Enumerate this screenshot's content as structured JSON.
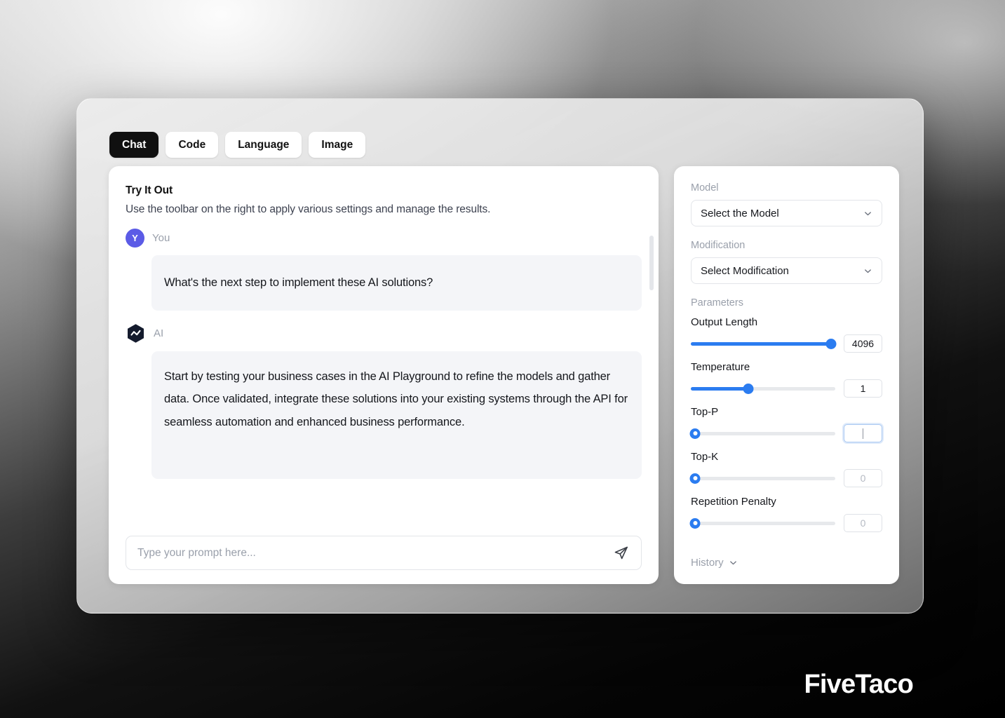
{
  "tabs": [
    {
      "label": "Chat",
      "active": true
    },
    {
      "label": "Code",
      "active": false
    },
    {
      "label": "Language",
      "active": false
    },
    {
      "label": "Image",
      "active": false
    }
  ],
  "chat": {
    "title": "Try It Out",
    "subtitle": "Use the toolbar on the right to apply various settings and manage the results.",
    "messages": [
      {
        "author": "You",
        "avatar_initial": "Y",
        "avatar_color": "#5b5be6",
        "text": "What's the next step to implement these AI solutions?"
      },
      {
        "author": "AI",
        "avatar_icon": "ai-hexagon-icon",
        "avatar_color": "#141b2d",
        "text": "Start by testing your business cases in the AI Playground to refine the models and gather data. Once validated, integrate these solutions into your existing systems through the API for seamless automation and enhanced business performance."
      }
    ],
    "composer": {
      "placeholder": "Type your prompt here...",
      "value": "",
      "send_icon": "send-paper-plane-icon"
    }
  },
  "settings": {
    "model": {
      "label": "Model",
      "selected": "Select the Model",
      "icon": "chevron-down-icon"
    },
    "modification": {
      "label": "Modification",
      "selected": "Select Modification",
      "icon": "chevron-down-icon"
    },
    "parameters_label": "Parameters",
    "parameters": [
      {
        "label": "Output Length",
        "value": "4096",
        "percent": 97,
        "filled": true,
        "muted": false,
        "focused": false
      },
      {
        "label": "Temperature",
        "value": "1",
        "percent": 40,
        "filled": true,
        "muted": false,
        "focused": false
      },
      {
        "label": "Top-P",
        "value": "",
        "percent": 3,
        "filled": false,
        "muted": false,
        "focused": true
      },
      {
        "label": "Top-K",
        "value": "0",
        "percent": 3,
        "filled": false,
        "muted": true,
        "focused": false
      },
      {
        "label": "Repetition Penalty",
        "value": "0",
        "percent": 3,
        "filled": false,
        "muted": true,
        "focused": false
      }
    ],
    "history": {
      "label": "History",
      "icon": "chevron-down-icon"
    }
  },
  "brand": {
    "name": "FiveTaco"
  },
  "colors": {
    "accent_blue": "#2b7cf0",
    "tab_active_bg": "#101010",
    "bubble_bg": "#f4f5f8",
    "avatar_purple": "#5b5be6"
  }
}
